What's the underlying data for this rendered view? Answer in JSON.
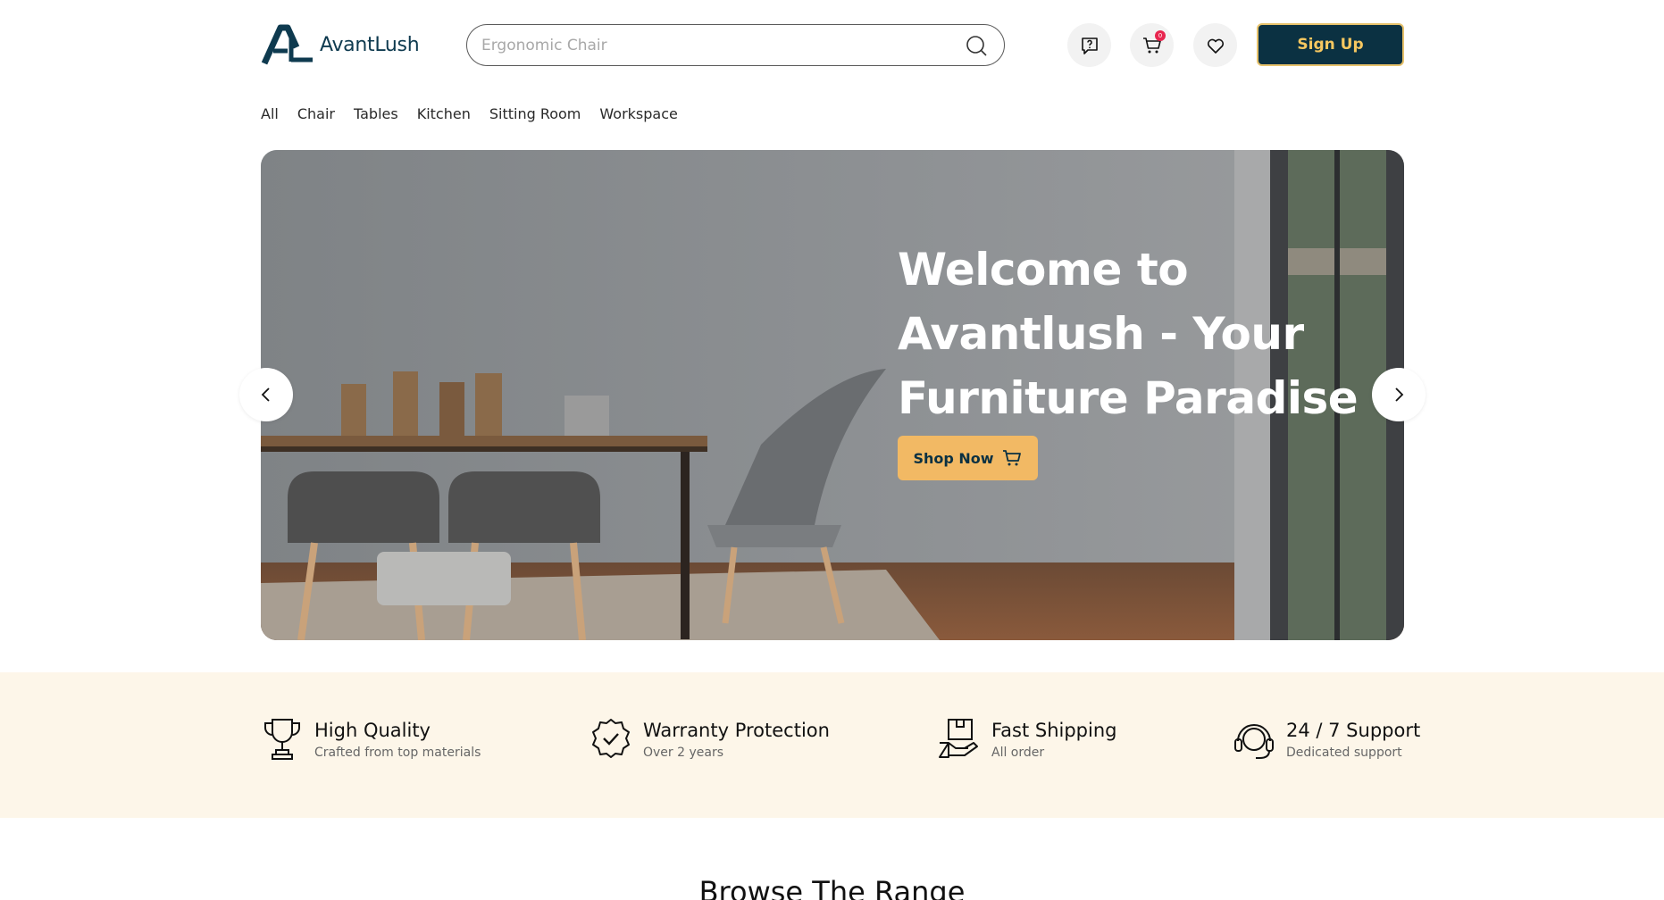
{
  "brand": {
    "name": "AvantLush"
  },
  "search": {
    "placeholder": "Ergonomic Chair",
    "value": ""
  },
  "header": {
    "help_icon": "question-bubble-icon",
    "cart_icon": "cart-icon",
    "cart_badge": "0",
    "wishlist_icon": "heart-icon",
    "signup_label": "Sign Up"
  },
  "categories": [
    "All",
    "Chair",
    "Tables",
    "Kitchen",
    "Sitting Room",
    "Workspace"
  ],
  "hero": {
    "title": "Welcome to Avantlush - Your Furniture Paradise",
    "cta_label": "Shop Now"
  },
  "features": [
    {
      "icon": "trophy-icon",
      "title": "High Quality",
      "subtitle": "Crafted from top materials"
    },
    {
      "icon": "badge-check-icon",
      "title": "Warranty Protection",
      "subtitle": "Over 2 years"
    },
    {
      "icon": "box-hand-icon",
      "title": "Fast Shipping",
      "subtitle": "All order"
    },
    {
      "icon": "headset-icon",
      "title": "24 / 7 Support",
      "subtitle": "Dedicated support"
    }
  ],
  "section": {
    "title": "Browse The Range"
  },
  "colors": {
    "primary": "#0b3142",
    "accent": "#f2b964",
    "feature_bg": "#fdf6e9",
    "badge": "#e8264f"
  }
}
